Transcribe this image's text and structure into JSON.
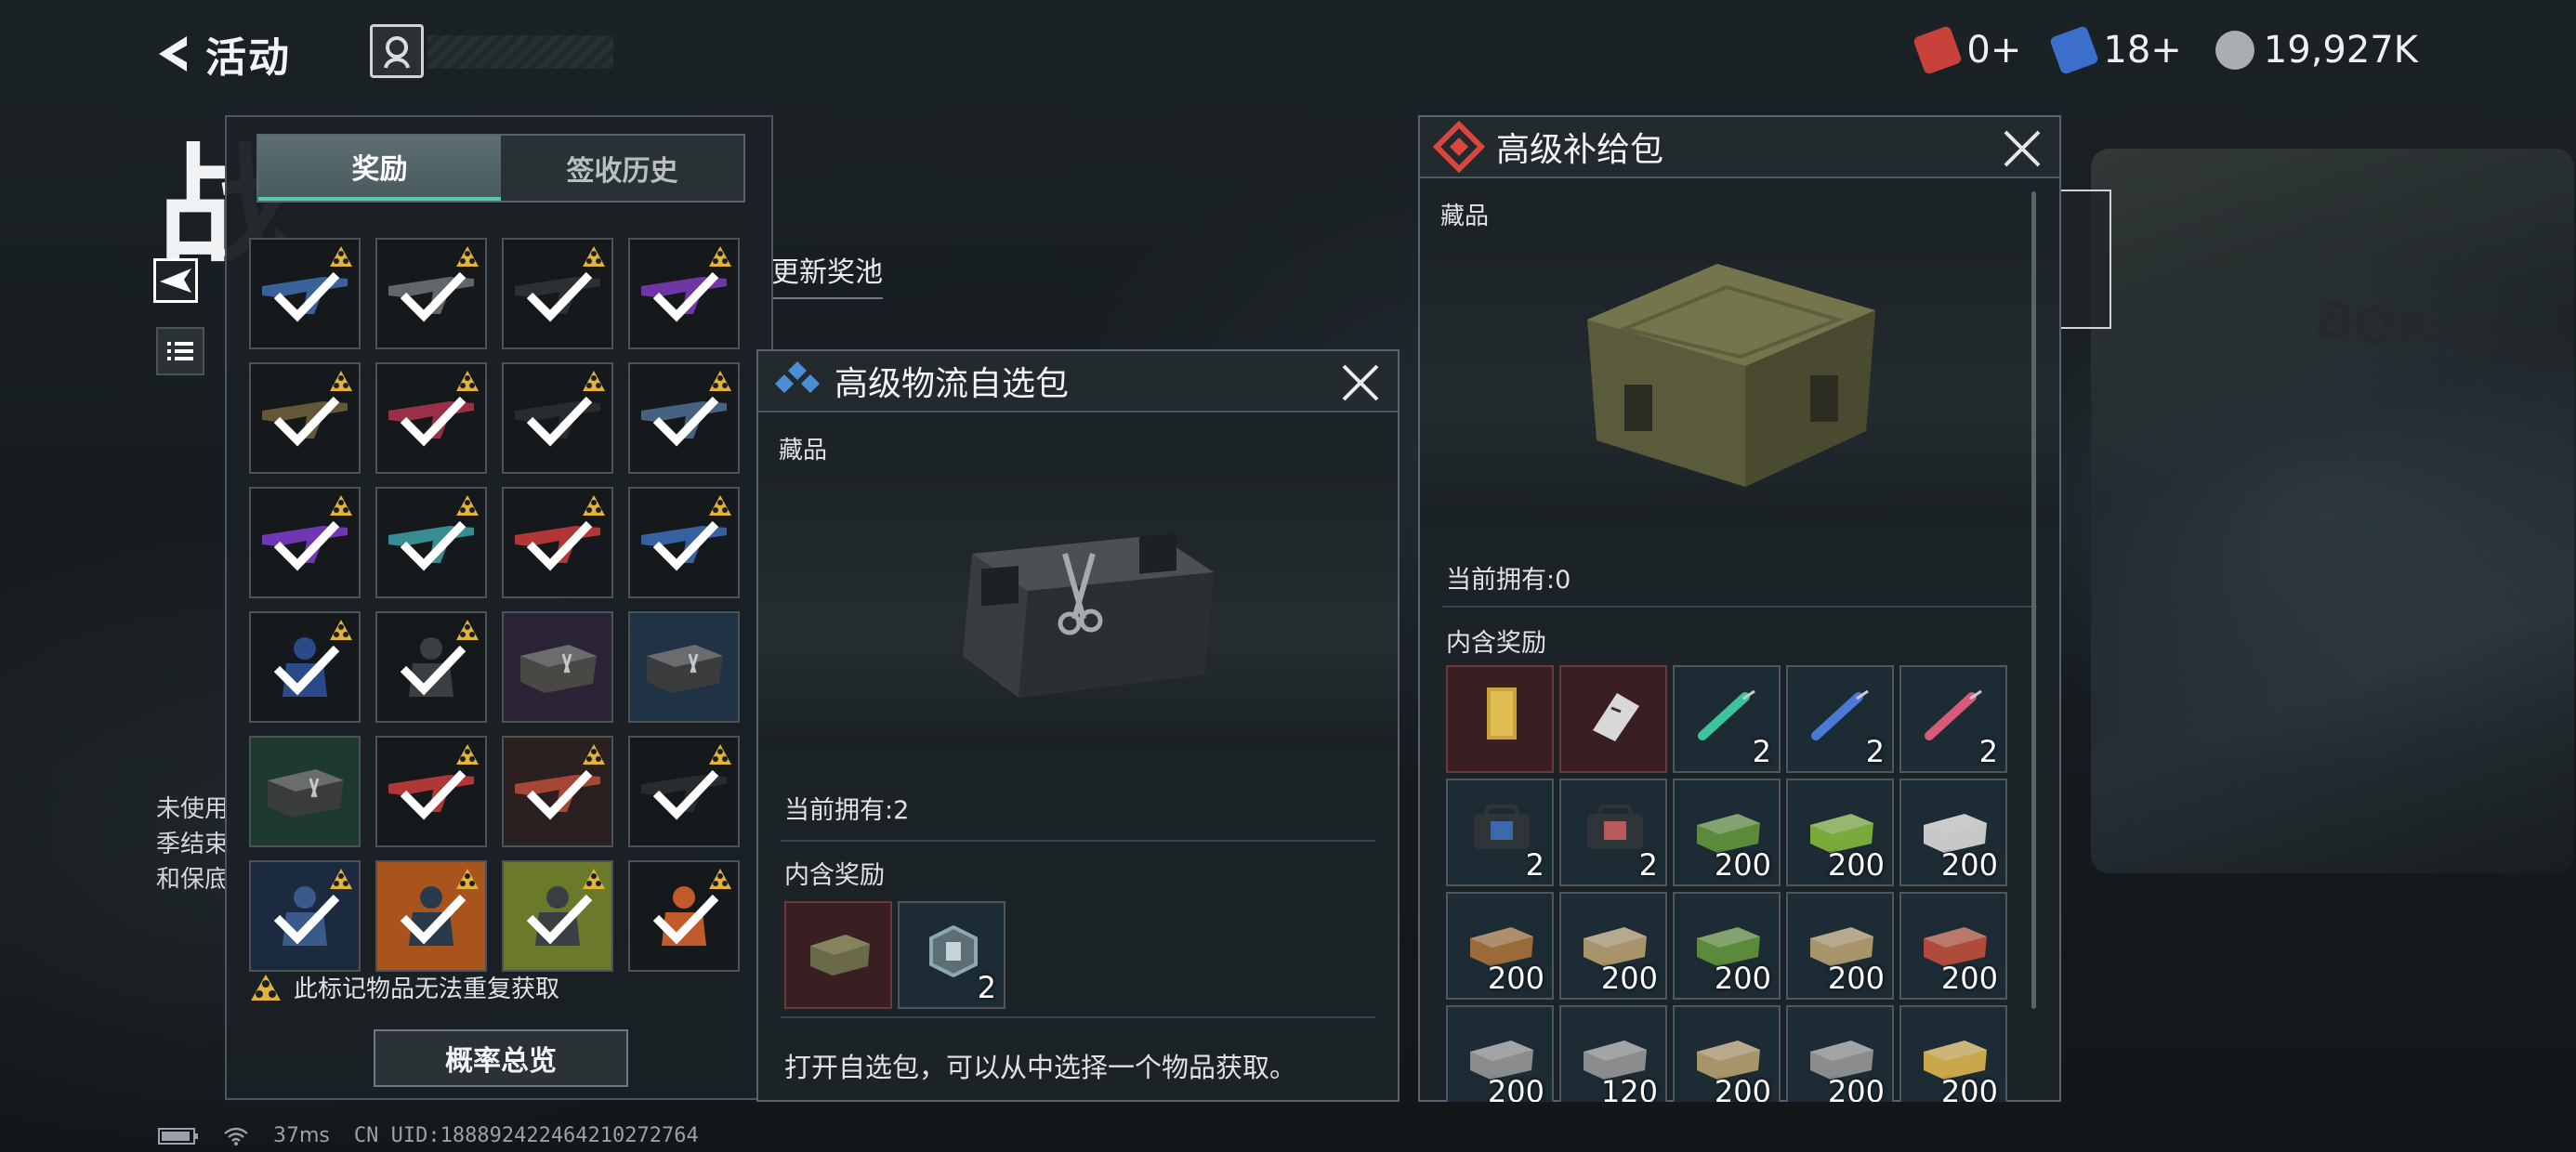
{
  "header": {
    "back_label": "活动",
    "currencies": [
      {
        "icon": "red-ticket-icon",
        "value": "0+",
        "color": "#c9413b"
      },
      {
        "icon": "blue-ticket-icon",
        "value": "18+",
        "color": "#3b6fc9"
      },
      {
        "icon": "silver-coin-icon",
        "value": "19,927K",
        "color": "#a9aeb2"
      }
    ]
  },
  "background": {
    "title_fragment": "战",
    "refresh_pool_label": "更新奖池",
    "notes": [
      "未使用",
      "季结束",
      "和保底"
    ],
    "crate_text": "BOF-17M"
  },
  "status_bar": {
    "ping": "37ms",
    "uid": "CN UID:1888924224642102​72764"
  },
  "reward_panel": {
    "tabs": [
      {
        "label": "奖励",
        "active": true
      },
      {
        "label": "签收历史",
        "active": false
      }
    ],
    "items": [
      {
        "kind": "gun",
        "color": "#3d6aa8",
        "bg": "#15191b",
        "unique": true,
        "claimed": true
      },
      {
        "kind": "gun",
        "color": "#6b6f72",
        "bg": "#15191b",
        "unique": true,
        "claimed": true
      },
      {
        "kind": "gun",
        "color": "#2f3336",
        "bg": "#15191b",
        "unique": true,
        "claimed": true
      },
      {
        "kind": "gun",
        "color": "#7a3ab8",
        "bg": "#15191b",
        "unique": true,
        "claimed": true
      },
      {
        "kind": "gun",
        "color": "#6b5e3a",
        "bg": "#15191b",
        "unique": true,
        "claimed": true
      },
      {
        "kind": "gun",
        "color": "#a8334a",
        "bg": "#15191b",
        "unique": true,
        "claimed": true
      },
      {
        "kind": "gun",
        "color": "#2b2f31",
        "bg": "#15191b",
        "unique": true,
        "claimed": true
      },
      {
        "kind": "gun",
        "color": "#4a6a8c",
        "bg": "#15191b",
        "unique": true,
        "claimed": true
      },
      {
        "kind": "gun",
        "color": "#7b3ac4",
        "bg": "#15191b",
        "unique": true,
        "claimed": true
      },
      {
        "kind": "gun",
        "color": "#3b9a9e",
        "bg": "#15191b",
        "unique": true,
        "claimed": true
      },
      {
        "kind": "gun",
        "color": "#c23a3a",
        "bg": "#15191b",
        "unique": true,
        "claimed": true
      },
      {
        "kind": "gun",
        "color": "#3a6ab0",
        "bg": "#15191b",
        "unique": true,
        "claimed": true
      },
      {
        "kind": "suit",
        "color": "#2a4a8a",
        "bg": "#15191b",
        "unique": true,
        "claimed": true
      },
      {
        "kind": "suit",
        "color": "#3a3f44",
        "bg": "#15191b",
        "unique": true,
        "claimed": true
      },
      {
        "kind": "box",
        "color": "#4a4844",
        "bg": "#2a2436",
        "unique": false,
        "claimed": false
      },
      {
        "kind": "box",
        "color": "#3a3c3e",
        "bg": "#1f3344",
        "unique": false,
        "claimed": false
      },
      {
        "kind": "box",
        "color": "#3a3c3e",
        "bg": "#1e3a2e",
        "unique": false,
        "claimed": false
      },
      {
        "kind": "gun",
        "color": "#c23a3a",
        "bg": "#15191b",
        "unique": true,
        "claimed": true
      },
      {
        "kind": "gun",
        "color": "#b54a3a",
        "bg": "#2a2020",
        "unique": true,
        "claimed": true
      },
      {
        "kind": "gun",
        "color": "#2b2f31",
        "bg": "#15191b",
        "unique": true,
        "claimed": true
      },
      {
        "kind": "suit",
        "color": "#3a5a8a",
        "bg": "#1c2a40",
        "unique": true,
        "claimed": true
      },
      {
        "kind": "suit",
        "color": "#2a3a4a",
        "bg": "#a8541c",
        "unique": true,
        "claimed": true
      },
      {
        "kind": "suit",
        "color": "#3a3f44",
        "bg": "#6b7a2a",
        "unique": true,
        "claimed": true
      },
      {
        "kind": "suit",
        "color": "#c25a2a",
        "bg": "#15191b",
        "unique": true,
        "claimed": true
      }
    ],
    "note": "此标记物品无法重复获取",
    "probability_button": "概率总览"
  },
  "logistics_popup": {
    "title": "高级物流自选包",
    "category": "藏品",
    "owned": "当前拥有:2",
    "contents_label": "内含奖励",
    "contents": [
      {
        "item": "green-crate-icon",
        "bg": "red",
        "count": ""
      },
      {
        "item": "hex-badge-icon",
        "bg": "blue",
        "count": "2"
      }
    ],
    "description": "打开自选包，可以从中选择一个物品获取。"
  },
  "supply_popup": {
    "title": "高级补给包",
    "category": "藏品",
    "owned": "当前拥有:0",
    "contents_label": "内含奖励",
    "contents": [
      {
        "item": "gold-bar-icon",
        "bg": "red",
        "count": ""
      },
      {
        "item": "keycard-icon",
        "bg": "red",
        "count": ""
      },
      {
        "item": "syringe-green-icon",
        "bg": "blue",
        "count": "2"
      },
      {
        "item": "syringe-blue-icon",
        "bg": "blue",
        "count": "2"
      },
      {
        "item": "syringe-red-icon",
        "bg": "blue",
        "count": "2"
      },
      {
        "item": "armor-pack-blue-icon",
        "bg": "blue",
        "count": "2"
      },
      {
        "item": "armor-pack-red-icon",
        "bg": "blue",
        "count": "2"
      },
      {
        "item": "ammo-box-green-icon",
        "bg": "blue",
        "count": "200"
      },
      {
        "item": "ammo-box-lime-icon",
        "bg": "blue",
        "count": "200"
      },
      {
        "item": "ammo-box-white-icon",
        "bg": "blue",
        "count": "200"
      },
      {
        "item": "ammo-box-brown-icon",
        "bg": "blue",
        "count": "200"
      },
      {
        "item": "ammo-box-tan-icon",
        "bg": "blue",
        "count": "200"
      },
      {
        "item": "ammo-box-green-icon",
        "bg": "blue",
        "count": "200"
      },
      {
        "item": "ammo-box-tan-icon",
        "bg": "blue",
        "count": "200"
      },
      {
        "item": "ammo-box-red-icon",
        "bg": "blue",
        "count": "200"
      },
      {
        "item": "ammo-box-gray-icon",
        "bg": "blue",
        "count": "200"
      },
      {
        "item": "ammo-box-gray-icon",
        "bg": "blue",
        "count": "120"
      },
      {
        "item": "ammo-box-tan-icon",
        "bg": "blue",
        "count": "200"
      },
      {
        "item": "ammo-box-gray-icon",
        "bg": "blue",
        "count": "200"
      },
      {
        "item": "ammo-box-gold-icon",
        "bg": "blue",
        "count": "200"
      }
    ]
  }
}
